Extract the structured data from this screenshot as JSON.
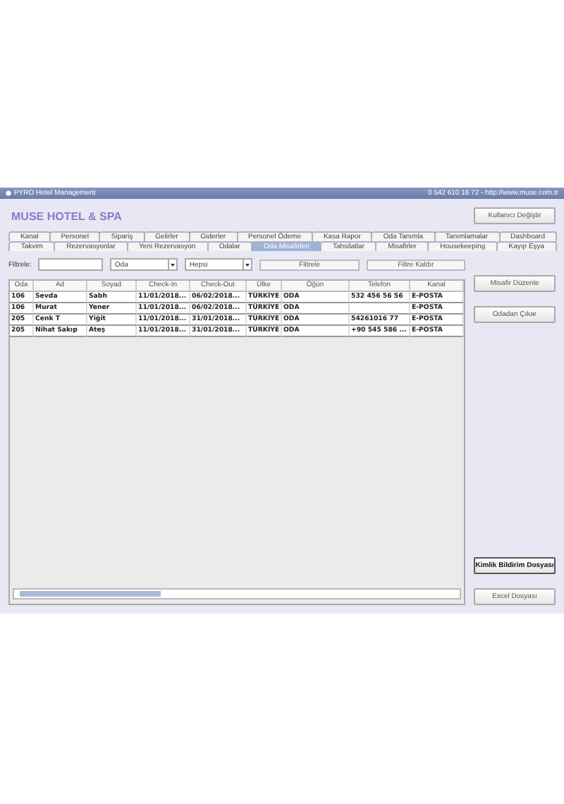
{
  "window": {
    "title": "PYRO Hotel Management",
    "contact": "0 542 610 16 72  -  http://www.muse.com.tr"
  },
  "header": {
    "hotel_name": "MUSE HOTEL & SPA",
    "button": "Kullanıcı Değiştir"
  },
  "tabs": {
    "row_1": [
      {
        "label": "Kanal",
        "selected": false
      },
      {
        "label": "Personel",
        "selected": false
      },
      {
        "label": "Sipariş",
        "selected": false
      },
      {
        "label": "Gelirler",
        "selected": false
      },
      {
        "label": "Giderler",
        "selected": false
      },
      {
        "label": "Personel Ödeme",
        "selected": false
      },
      {
        "label": "Kasa Rapor",
        "selected": false
      },
      {
        "label": "Oda Tanımla",
        "selected": false
      },
      {
        "label": "Tanımlamalar",
        "selected": false
      },
      {
        "label": "Dashboard",
        "selected": false
      }
    ],
    "row_2": [
      {
        "label": "Takvim",
        "selected": false
      },
      {
        "label": "Rezervasyonlar",
        "selected": false
      },
      {
        "label": "Yeni Rezervasyon",
        "selected": false
      },
      {
        "label": "Odalar",
        "selected": false
      },
      {
        "label": "Oda Misafirleri",
        "selected": true
      },
      {
        "label": "Tahsilatlar",
        "selected": false
      },
      {
        "label": "Misafirler",
        "selected": false
      },
      {
        "label": "Housekeeping",
        "selected": false
      },
      {
        "label": "Kayıp Eşya",
        "selected": false
      }
    ]
  },
  "filter": {
    "label": "Filtrele:",
    "select_1": "Oda",
    "select_2": "Hepsi",
    "buttons": [
      "Filtrele",
      "Filtre Kaldır"
    ]
  },
  "table": {
    "columns": [
      "Oda",
      "Ad",
      "Soyad",
      "Check-In",
      "Check-Out",
      "Ülke",
      "Öğün",
      "Telefon",
      "Kanal"
    ],
    "rows": [
      [
        "106",
        "Sevda",
        "Sabh",
        "11/01/2018...",
        "06/02/2018...",
        "TÜRKİYE",
        "ODA",
        "532 456 56 56",
        "E-POSTA"
      ],
      [
        "106",
        "Murat",
        "Yener",
        "11/01/2018...",
        "06/02/2018...",
        "TÜRKİYE",
        "ODA",
        "",
        "E-POSTA"
      ],
      [
        "205",
        "Cenk T",
        "Yiğit",
        "11/01/2018...",
        "31/01/2018...",
        "TÜRKİYE",
        "ODA",
        "54261016 77",
        "E-POSTA"
      ],
      [
        "205",
        "Nihat Sakıp",
        "Ateş",
        "11/01/2018...",
        "31/01/2018...",
        "TÜRKİYE",
        "ODA",
        "+90 545 586 ...",
        "E-POSTA"
      ]
    ]
  },
  "side_buttons": [
    {
      "label": "Misafir Düzenle",
      "focused": false
    },
    {
      "label": "Odadan Çıkar",
      "focused": false
    },
    {
      "label": "Kimlik Bildirim Dosyası",
      "focused": true
    },
    {
      "label": "Excel Dosyası",
      "focused": false
    }
  ]
}
